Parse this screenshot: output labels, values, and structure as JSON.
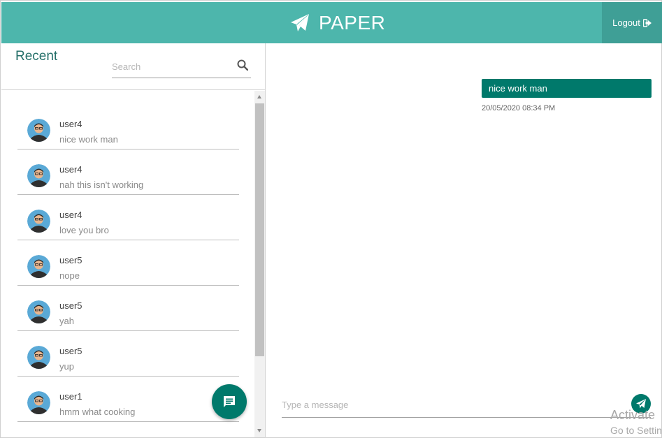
{
  "header": {
    "brand_icon": "paper-plane-icon",
    "title": "PAPER",
    "logout_label": "Logout",
    "logout_icon": "sign-out-icon",
    "colors": {
      "header_bg": "#4db6ac",
      "logout_bg": "#3f9f96"
    }
  },
  "sidebar": {
    "title": "Recent",
    "search": {
      "placeholder": "Search",
      "value": "",
      "icon": "search-icon"
    },
    "conversations": [
      {
        "user": "user4",
        "message": "nice work man"
      },
      {
        "user": "user4",
        "message": "nah this isn't working"
      },
      {
        "user": "user4",
        "message": "love you bro"
      },
      {
        "user": "user5",
        "message": "nope"
      },
      {
        "user": "user5",
        "message": "yah"
      },
      {
        "user": "user5",
        "message": "yup"
      },
      {
        "user": "user1",
        "message": "hmm what cooking"
      }
    ],
    "fab_icon": "chat-icon"
  },
  "chat": {
    "messages": [
      {
        "text": "nice work man",
        "timestamp": "20/05/2020 08:34 PM"
      }
    ],
    "compose": {
      "placeholder": "Type a message",
      "value": "",
      "send_icon": "send-icon"
    },
    "colors": {
      "bubble_bg": "#00796b",
      "accent": "#00796b"
    }
  },
  "overlay": {
    "activate_title": "Activate",
    "activate_sub": "Go to Settin"
  }
}
